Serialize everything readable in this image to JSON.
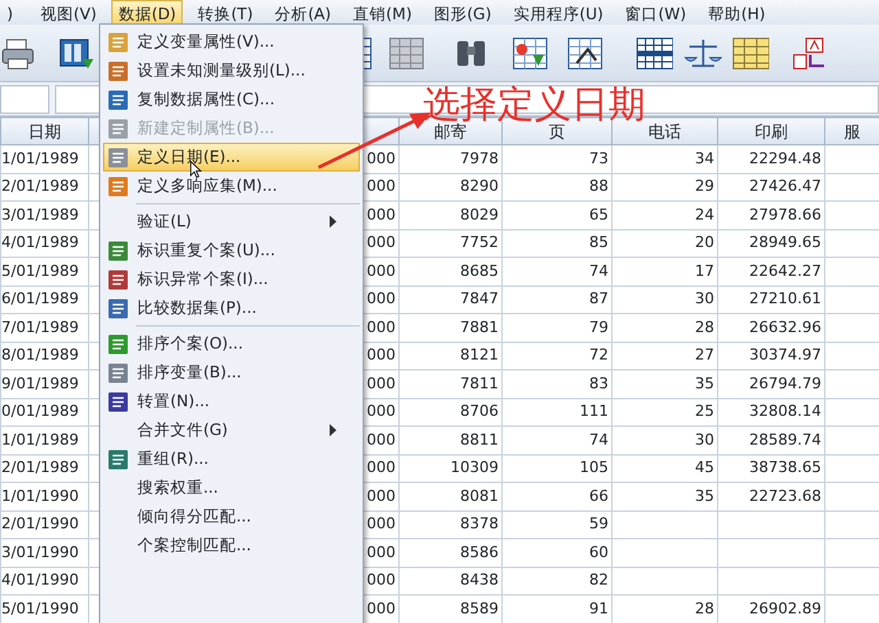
{
  "menu_bar": [
    {
      "label": ")",
      "selected": false
    },
    {
      "label": "视图(V)",
      "selected": false
    },
    {
      "label": "数据(D)",
      "selected": true
    },
    {
      "label": "转换(T)",
      "selected": false
    },
    {
      "label": "分析(A)",
      "selected": false
    },
    {
      "label": "直销(M)",
      "selected": false
    },
    {
      "label": "图形(G)",
      "selected": false
    },
    {
      "label": "实用程序(U)",
      "selected": false
    },
    {
      "label": "窗口(W)",
      "selected": false
    },
    {
      "label": "帮助(H)",
      "selected": false
    }
  ],
  "data_menu": [
    {
      "kind": "icon_item",
      "label": "定义变量属性(V)...",
      "selected": false,
      "disabled": false
    },
    {
      "kind": "icon_item",
      "label": "设置未知测量级别(L)...",
      "selected": false,
      "disabled": false
    },
    {
      "kind": "icon_item",
      "label": "复制数据属性(C)...",
      "selected": false,
      "disabled": false
    },
    {
      "kind": "icon_item",
      "label": "新建定制属性(B)...",
      "selected": false,
      "disabled": true
    },
    {
      "kind": "icon_item",
      "label": "定义日期(E)...",
      "selected": true,
      "disabled": false
    },
    {
      "kind": "icon_item",
      "label": "定义多响应集(M)...",
      "selected": false,
      "disabled": false
    },
    {
      "kind": "separator"
    },
    {
      "kind": "submenu",
      "label": "验证(L)",
      "selected": false,
      "disabled": false
    },
    {
      "kind": "icon_item",
      "label": "标识重复个案(U)...",
      "selected": false,
      "disabled": false
    },
    {
      "kind": "icon_item",
      "label": "标识异常个案(I)...",
      "selected": false,
      "disabled": false
    },
    {
      "kind": "icon_item",
      "label": "比较数据集(P)...",
      "selected": false,
      "disabled": false
    },
    {
      "kind": "separator"
    },
    {
      "kind": "icon_item",
      "label": "排序个案(O)...",
      "selected": false,
      "disabled": false
    },
    {
      "kind": "icon_item",
      "label": "排序变量(B)...",
      "selected": false,
      "disabled": false
    },
    {
      "kind": "icon_item",
      "label": "转置(N)...",
      "selected": false,
      "disabled": false
    },
    {
      "kind": "submenu",
      "label": "合并文件(G)",
      "selected": false,
      "disabled": false
    },
    {
      "kind": "icon_item",
      "label": "重组(R)...",
      "selected": false,
      "disabled": false
    },
    {
      "kind": "plain_item",
      "label": "搜索权重...",
      "selected": false,
      "disabled": false
    },
    {
      "kind": "plain_item",
      "label": "倾向得分匹配...",
      "selected": false,
      "disabled": false
    },
    {
      "kind": "plain_item",
      "label": "个案控制匹配...",
      "selected": false,
      "disabled": false
    }
  ],
  "annotation": {
    "text": "选择定义日期"
  },
  "table": {
    "columns": [
      {
        "label": "日期"
      },
      {},
      {},
      {
        "label": "邮寄"
      },
      {
        "label": "页"
      },
      {
        "label": "电话"
      },
      {
        "label": "印刷"
      },
      {
        "label": "服"
      }
    ],
    "rows": [
      [
        "1/01/1989",
        null,
        "000",
        "7978",
        "73",
        "34",
        "22294.48",
        null
      ],
      [
        "2/01/1989",
        null,
        "000",
        "8290",
        "88",
        "29",
        "27426.47",
        null
      ],
      [
        "3/01/1989",
        null,
        "000",
        "8029",
        "65",
        "24",
        "27978.66",
        null
      ],
      [
        "4/01/1989",
        null,
        "000",
        "7752",
        "85",
        "20",
        "28949.65",
        null
      ],
      [
        "5/01/1989",
        null,
        "000",
        "8685",
        "74",
        "17",
        "22642.27",
        null
      ],
      [
        "6/01/1989",
        null,
        "000",
        "7847",
        "87",
        "30",
        "27210.61",
        null
      ],
      [
        "7/01/1989",
        null,
        "000",
        "7881",
        "79",
        "28",
        "26632.96",
        null
      ],
      [
        "8/01/1989",
        null,
        "000",
        "8121",
        "72",
        "27",
        "30374.97",
        null
      ],
      [
        "9/01/1989",
        null,
        "000",
        "7811",
        "83",
        "35",
        "26794.79",
        null
      ],
      [
        "0/01/1989",
        null,
        "000",
        "8706",
        "111",
        "25",
        "32808.14",
        null
      ],
      [
        "1/01/1989",
        null,
        "000",
        "8811",
        "74",
        "30",
        "28589.74",
        null
      ],
      [
        "2/01/1989",
        null,
        "000",
        "10309",
        "105",
        "45",
        "38738.65",
        null
      ],
      [
        "1/01/1990",
        null,
        "000",
        "8081",
        "66",
        "35",
        "22723.68",
        null
      ],
      [
        "2/01/1990",
        null,
        "000",
        "8378",
        "59",
        null,
        null,
        null
      ],
      [
        "3/01/1990",
        null,
        "000",
        "8586",
        "60",
        null,
        null,
        null
      ],
      [
        "4/01/1990",
        null,
        "000",
        "8438",
        "82",
        null,
        null,
        null
      ],
      [
        "5/01/1990",
        null,
        "000",
        "8589",
        "91",
        "28",
        "26902.89",
        null
      ]
    ]
  }
}
